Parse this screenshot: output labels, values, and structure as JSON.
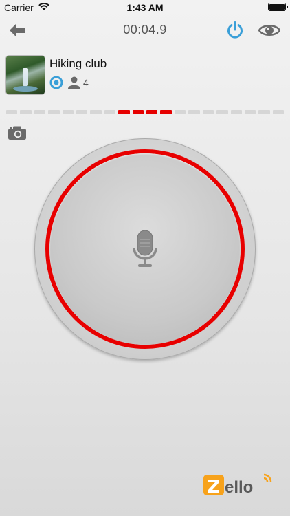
{
  "status_bar": {
    "carrier": "Carrier",
    "time": "1:43 AM",
    "icons": [
      "wifi-icon",
      "battery-icon"
    ]
  },
  "top_bar": {
    "timer": "00:04.9",
    "icons": [
      "back-arrow-icon",
      "power-icon",
      "eye-icon"
    ]
  },
  "channel": {
    "name": "Hiking club",
    "user_count": "4",
    "status": "online",
    "icons": [
      "channel-thumbnail",
      "status-online-icon",
      "user-icon"
    ]
  },
  "level_meter": {
    "segments": 20,
    "active_from": 8,
    "active_to": 11
  },
  "camera": {
    "icon": "camera-icon"
  },
  "ptt": {
    "state": "transmitting",
    "icon": "microphone-icon"
  },
  "logo": {
    "text": "Zello"
  },
  "colors": {
    "accent_blue": "#3a9fd8",
    "ptt_red": "#e80000",
    "logo_orange": "#f7a21b",
    "icon_gray": "#6a6a6a"
  }
}
